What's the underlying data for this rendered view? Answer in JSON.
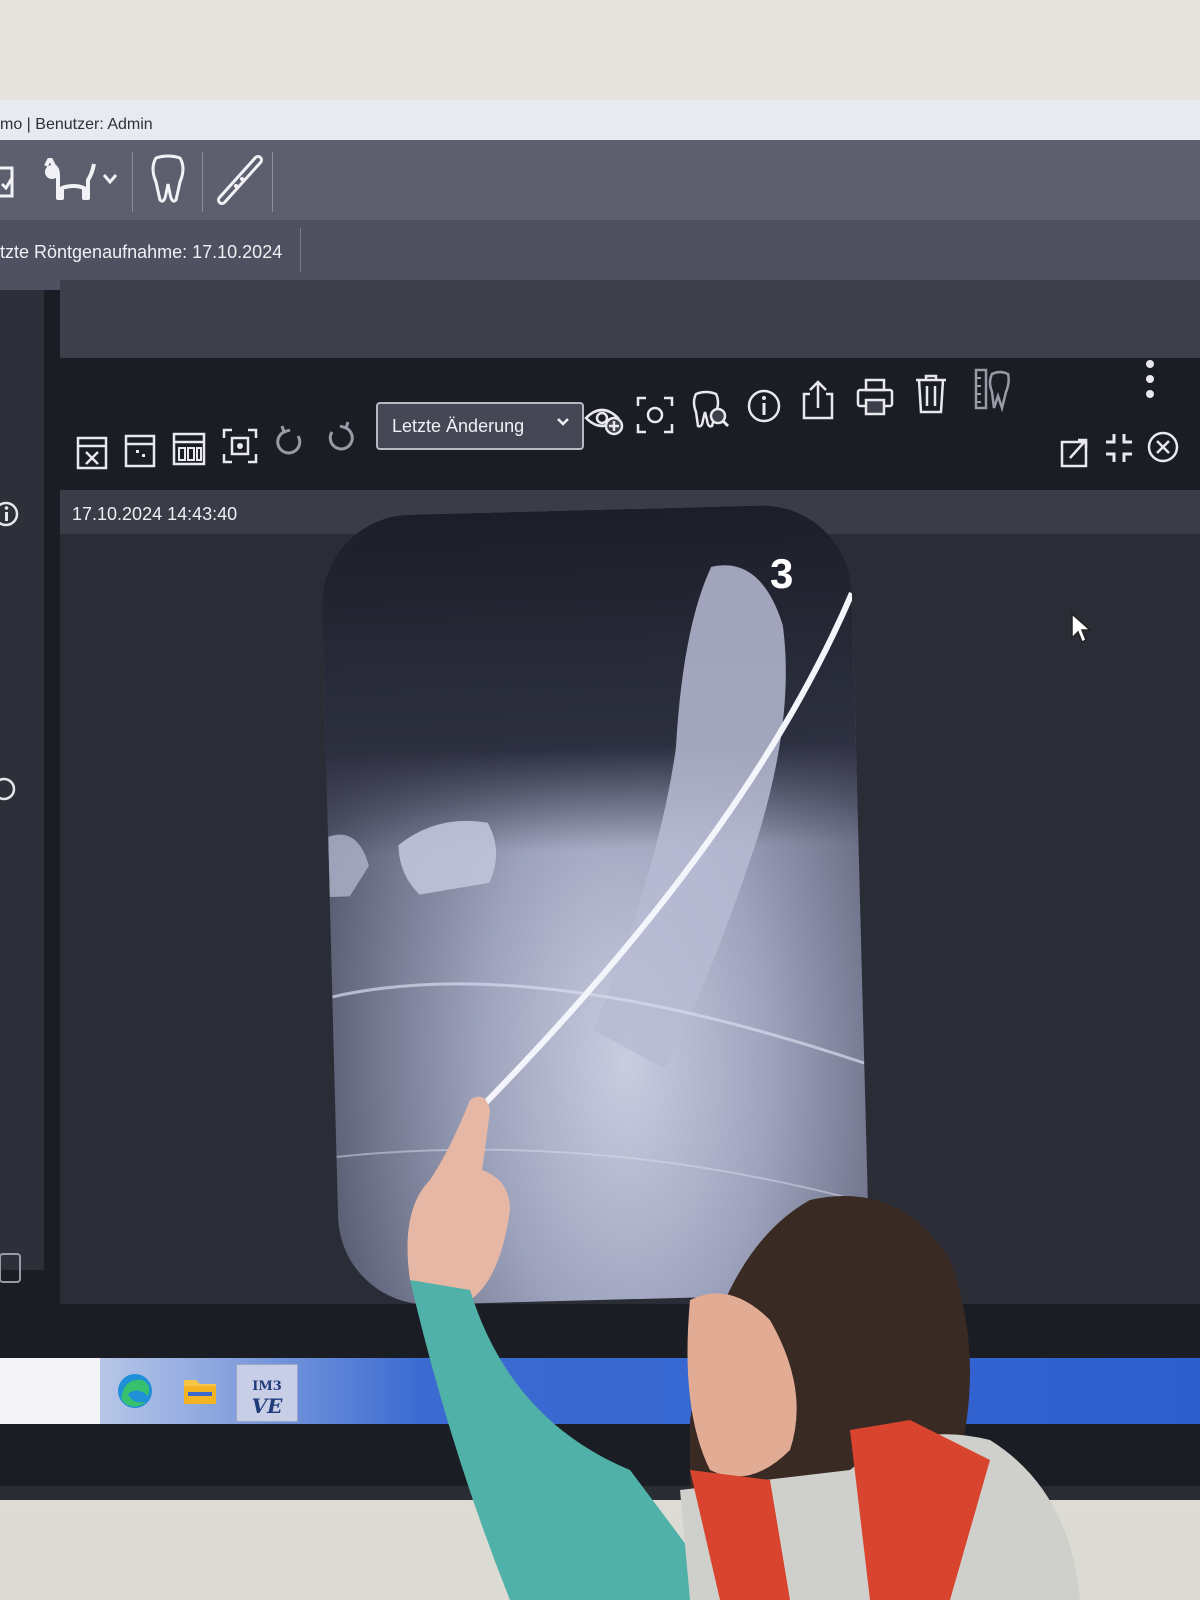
{
  "window": {
    "title_fragment": "mo | Benutzer: Admin"
  },
  "toolbar_top": {
    "icons": [
      "checklist-icon",
      "cat-icon",
      "chevron-down-icon",
      "tooth-icon",
      "xray-sensor-icon"
    ]
  },
  "infobar": {
    "last_xray_label": "tzte Röntgenaufnahme: 17.10.2024"
  },
  "viewer_toolbar": {
    "sort_dropdown_value": "Letzte Änderung",
    "icons": [
      "layout-close-icon",
      "layout-grid-icon",
      "layout-multi-icon",
      "focus-frame-icon",
      "rotate-left-icon",
      "rotate-right-icon",
      "eye-add-icon",
      "crop-focus-icon",
      "tooth-search-icon",
      "info-icon",
      "export-icon",
      "print-icon",
      "delete-icon",
      "ruler-tooth-icon",
      "more-vertical-icon",
      "external-open-icon",
      "collapse-icon",
      "close-icon"
    ]
  },
  "image_viewer": {
    "timestamp": "17.10.2024 14:43:40",
    "image_number": "3"
  },
  "taskbar": {
    "app_label_line1": "IM3",
    "app_label_line2": "VE",
    "icons": [
      "edge-browser-icon",
      "file-explorer-icon",
      "im3-vet-app-icon"
    ]
  },
  "colors": {
    "toolbar": "#5d5f6f",
    "infobar": "#4f5160",
    "viewer_bg": "#2a2d36",
    "taskbar_accent": "#2f5fcf"
  }
}
